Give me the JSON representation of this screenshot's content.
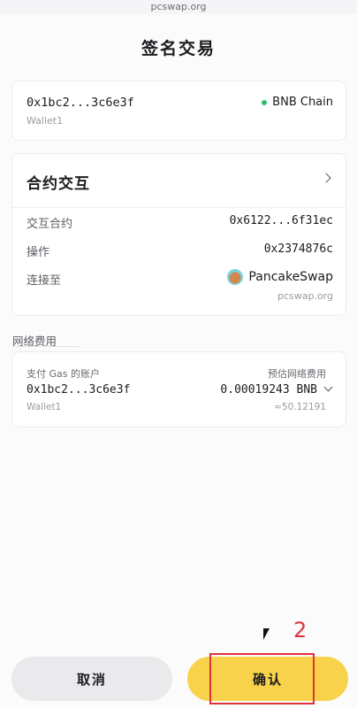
{
  "domain_bar": "pcswap.org",
  "title": "签名交易",
  "account": {
    "address": "0x1bc2...3c6e3f",
    "wallet": "Wallet1",
    "chain": "BNB Chain"
  },
  "contract": {
    "section_title": "合约交互",
    "rows": [
      {
        "label": "交互合约",
        "value": "0x6122...6f31ec"
      },
      {
        "label": "操作",
        "value": "0x2374876c"
      },
      {
        "label": "连接至",
        "value": "PancakeSwap"
      }
    ],
    "connected_domain": "pcswap.org"
  },
  "fee": {
    "heading": "网络费用",
    "payer_label": "支付 Gas 的账户",
    "estimate_label": "预估网络费用",
    "address": "0x1bc2...3c6e3f",
    "amount": "0.00019243 BNB",
    "wallet": "Wallet1",
    "fiat": "≈50.12191"
  },
  "buttons": {
    "cancel": "取消",
    "confirm": "确认"
  },
  "annotation": {
    "step_number": "2"
  },
  "colors": {
    "accent": "#f8d24a",
    "annotation": "#e0323a",
    "chain_dot": "#2bbf6a"
  }
}
